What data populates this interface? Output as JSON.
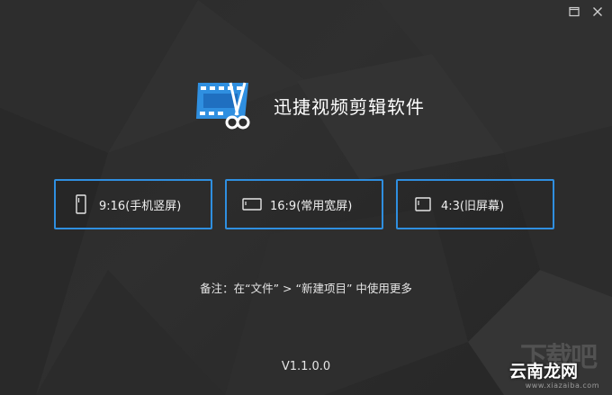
{
  "window": {
    "maximize_icon": "maximize-icon",
    "close_icon": "close-icon"
  },
  "app": {
    "title": "迅捷视频剪辑软件",
    "logo_icon": "film-scissors-icon",
    "accent_color": "#2f8fe0"
  },
  "ratios": [
    {
      "label": "9:16(手机竖屏)",
      "icon": "portrait-frame-icon"
    },
    {
      "label": "16:9(常用宽屏)",
      "icon": "landscape-frame-icon"
    },
    {
      "label": "4:3(旧屏幕)",
      "icon": "standard-frame-icon"
    }
  ],
  "note": "备注：在“文件” > “新建项目” 中使用更多",
  "version": "V1.1.0.0",
  "watermark": {
    "top": "下载吧",
    "brand": "云南龙网",
    "url": "www.xiazaiba.com"
  }
}
